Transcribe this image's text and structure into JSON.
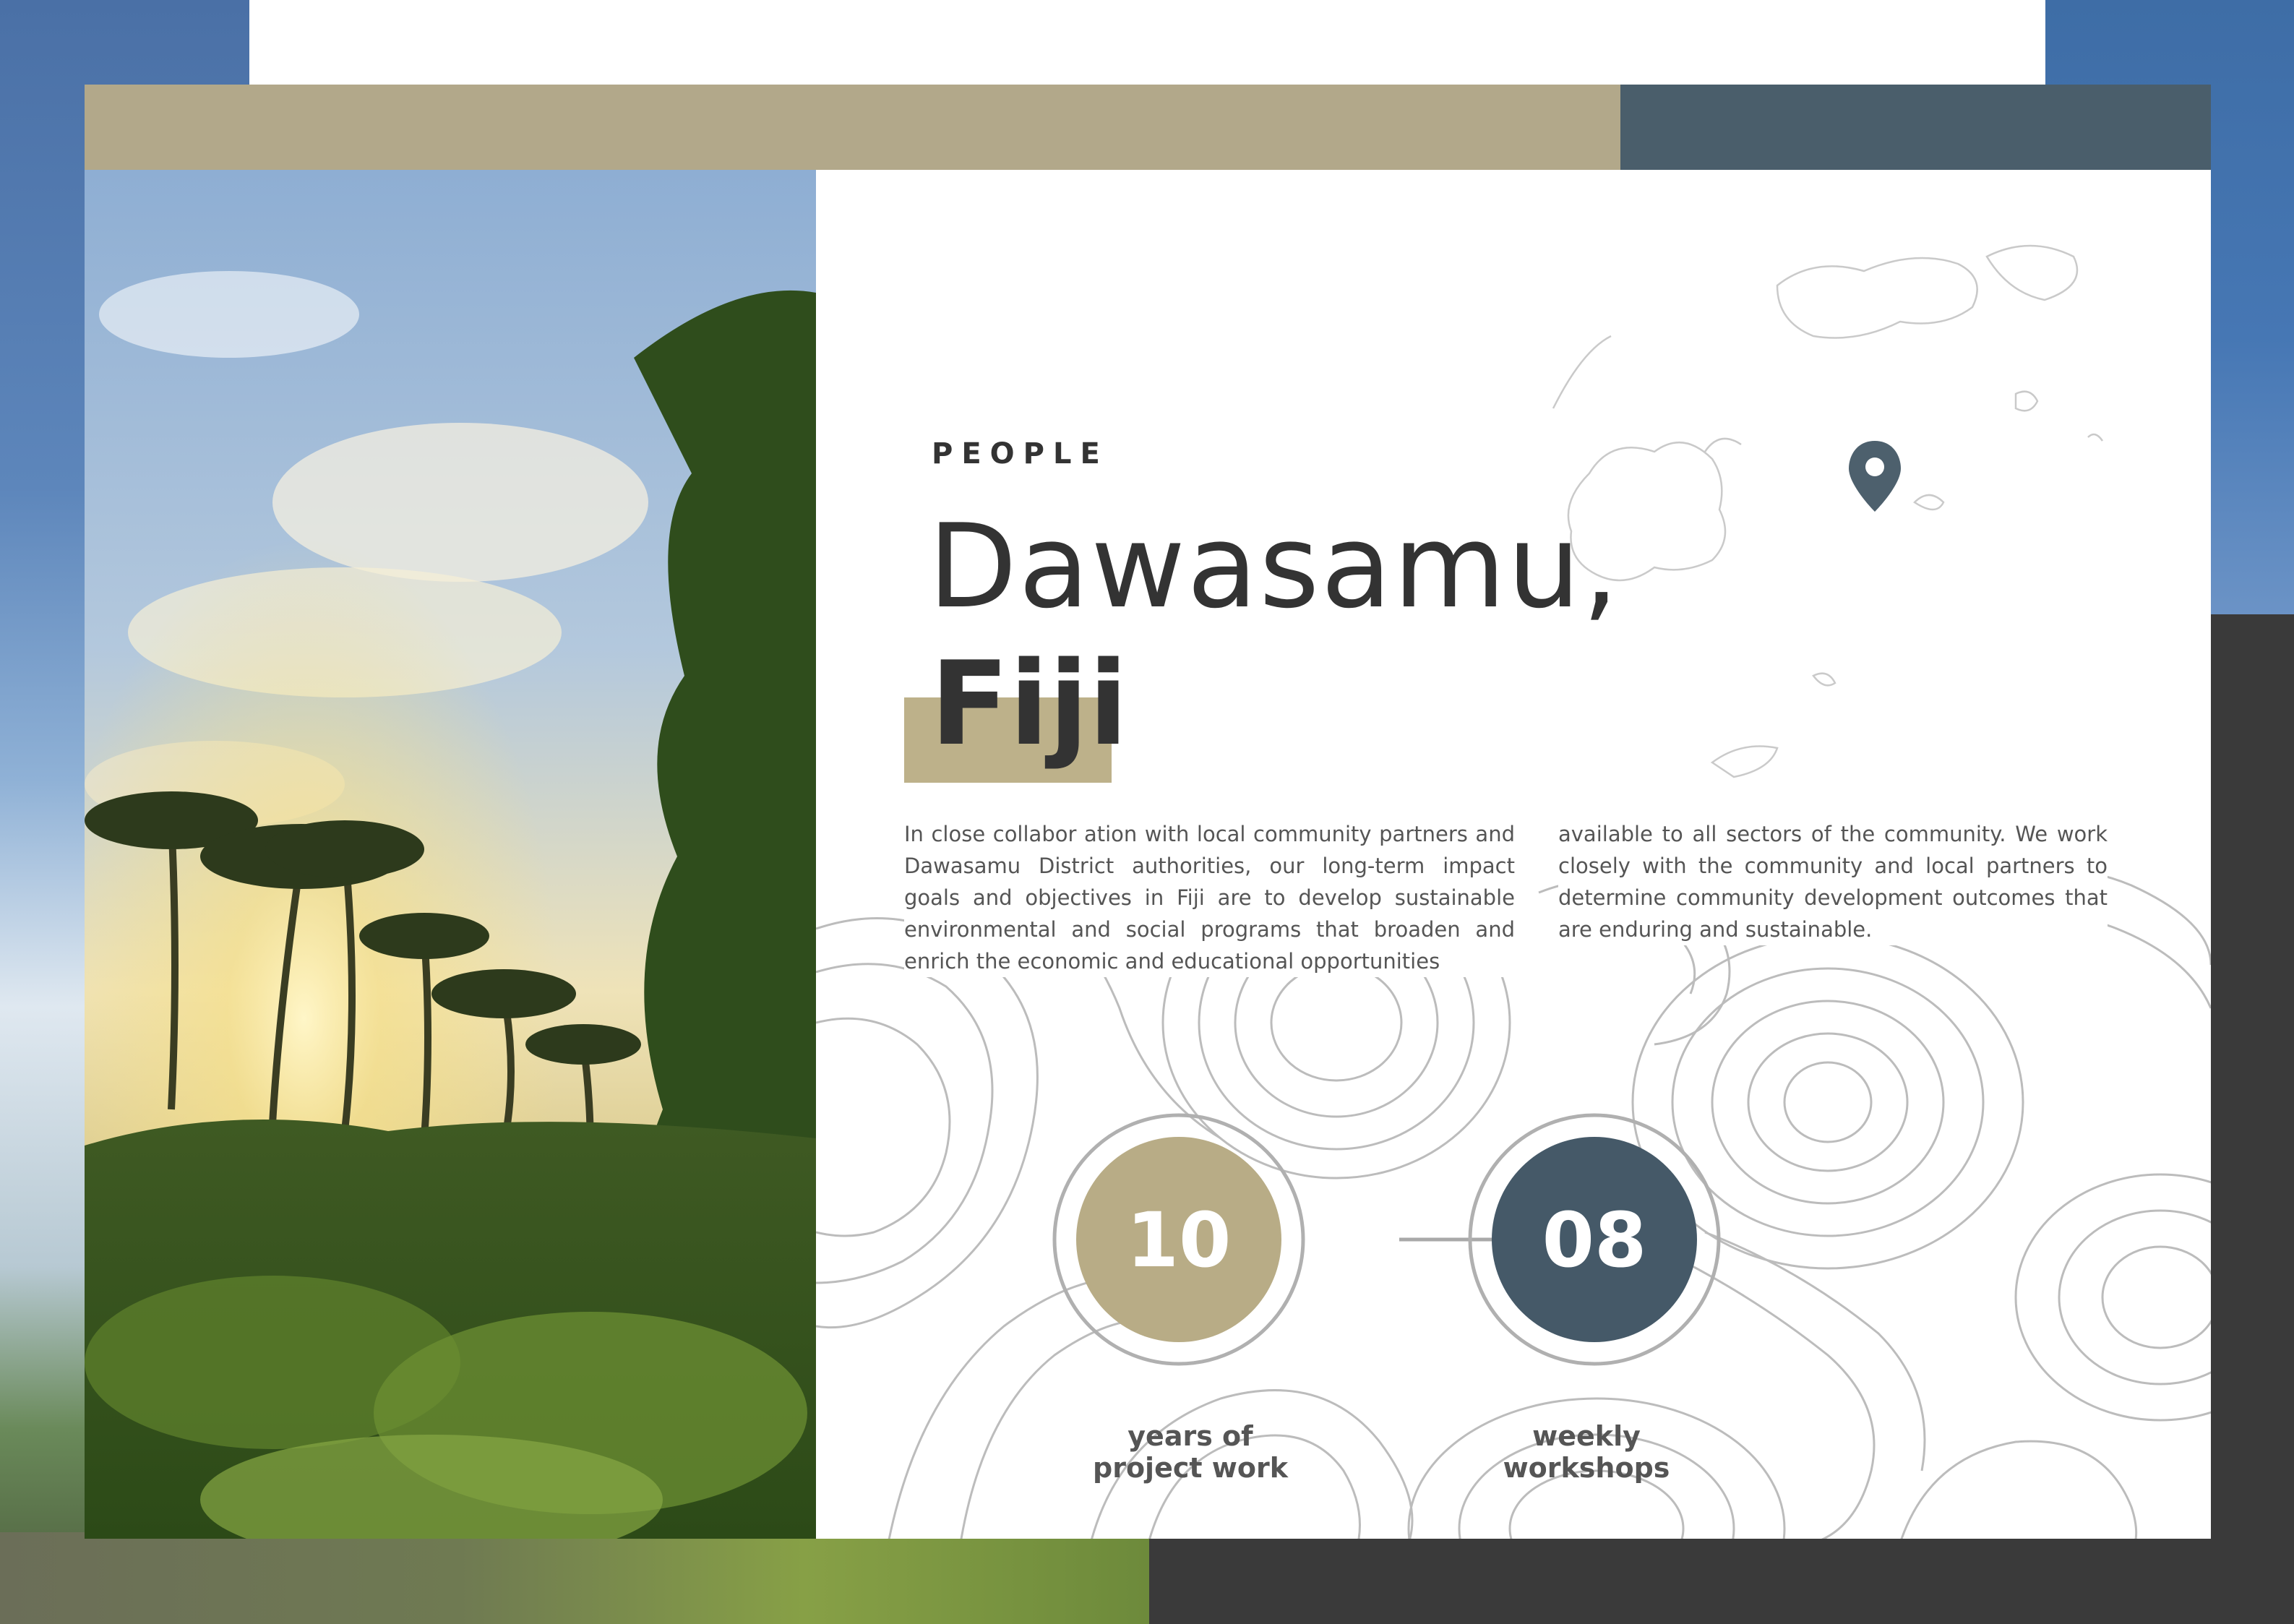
{
  "section_label": "PEOPLE",
  "title": {
    "line1": "Dawasamu,",
    "line2": "Fiji"
  },
  "body": {
    "left_paragraph": "In close collabor ation with local community partners and Dawasamu District authorities, our long-term impact goals and objectives in Fiji are to develop sustainable environmental and social programs that broaden and enrich the economic and educational opportunities",
    "right_paragraph": "available to all sectors of the community. We work closely with the community and local partners to determine community development outcomes that are enduring and sustainable."
  },
  "stats": [
    {
      "value": "10",
      "label_line1": "years of",
      "label_line2": "project work",
      "color": "#b8ac86"
    },
    {
      "value": "08",
      "label_line1": "weekly",
      "label_line2": "workshops",
      "color": "#455968"
    }
  ],
  "colors": {
    "tan": "#b2a88a",
    "slate": "#4a5e6b",
    "text_dark": "#333333",
    "text_body": "#555555"
  },
  "icons": {
    "map": "fiji-map-outline",
    "pin": "location-pin-icon"
  }
}
